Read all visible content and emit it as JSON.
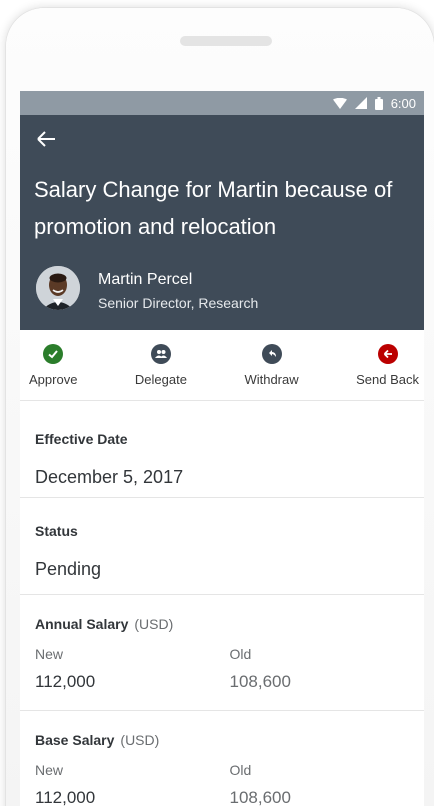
{
  "status_bar": {
    "time": "6:00"
  },
  "header": {
    "title": "Salary Change for Martin because of promotion and relocation",
    "person": {
      "name": "Martin Percel",
      "role": "Senior Director, Research"
    }
  },
  "actions": [
    {
      "label": "Approve",
      "icon": "check-icon",
      "color": "#2b7d2b"
    },
    {
      "label": "Delegate",
      "icon": "group-icon",
      "color": "#3f4b58"
    },
    {
      "label": "Withdraw",
      "icon": "undo-icon",
      "color": "#3f4b58"
    },
    {
      "label": "Send Back",
      "icon": "arrow-left-icon",
      "color": "#bb0000"
    }
  ],
  "fields": {
    "effective_date": {
      "label": "Effective Date",
      "value": "December 5, 2017"
    },
    "status": {
      "label": "Status",
      "value": "Pending"
    },
    "annual_salary": {
      "label": "Annual Salary",
      "unit": "(USD)",
      "new_label": "New",
      "new_value": "112,000",
      "old_label": "Old",
      "old_value": "108,600"
    },
    "base_salary": {
      "label": "Base Salary",
      "unit": "(USD)",
      "new_label": "New",
      "new_value": "112,000",
      "old_label": "Old",
      "old_value": "108,600"
    }
  },
  "colors": {
    "header_bg": "#3f4b58",
    "status_bar_bg": "#8f9aa4"
  }
}
